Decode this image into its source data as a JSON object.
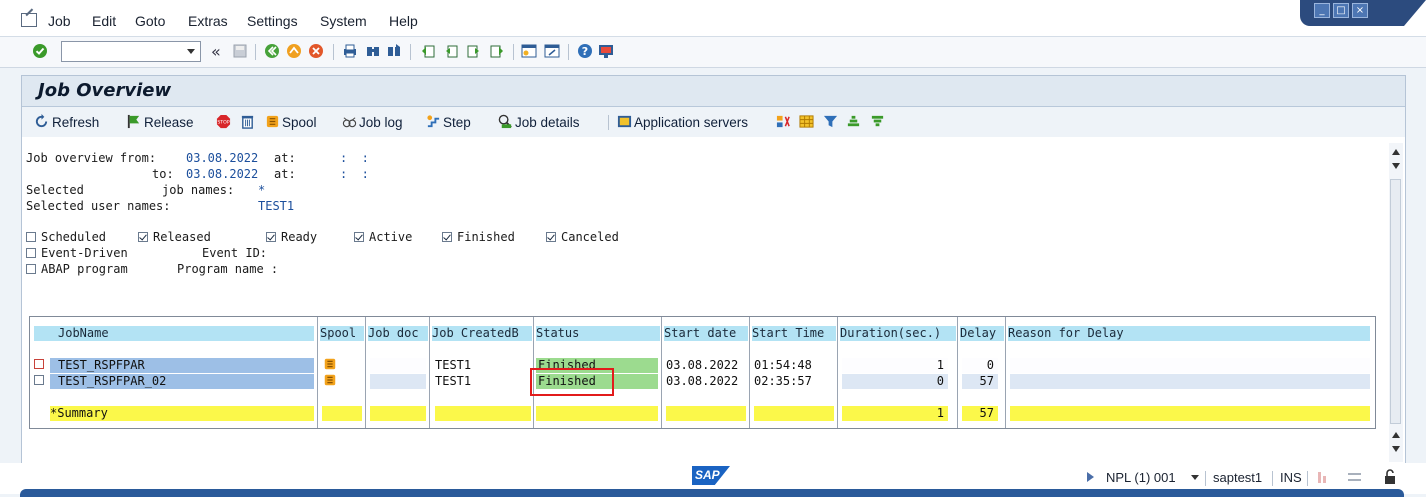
{
  "menu": {
    "items": [
      "Job",
      "Edit",
      "Goto",
      "Extras",
      "Settings",
      "System",
      "Help"
    ]
  },
  "window_controls": {
    "minimize": "_",
    "maximize": "□",
    "close": "×"
  },
  "toolbar": {
    "back_label": "«",
    "icons": [
      "enter-icon",
      "save-icon",
      "back-icon",
      "exit-icon",
      "cancel-icon",
      "print-icon",
      "find-icon",
      "find-next-icon",
      "first-page-icon",
      "previous-page-icon",
      "next-page-icon",
      "last-page-icon",
      "create-session-icon",
      "shortcut-icon",
      "help-icon",
      "customize-layout-icon"
    ]
  },
  "page": {
    "title": "Job Overview"
  },
  "app_toolbar": {
    "refresh": "Refresh",
    "release": "Release",
    "spool": "Spool",
    "job_log": "Job log",
    "step": "Step",
    "job_details": "Job details",
    "application_servers": "Application servers"
  },
  "criteria": {
    "overview_from_label": "Job overview from:",
    "from_date": "03.08.2022",
    "at_label1": "at:",
    "from_time": ":  :",
    "to_label": "to:",
    "to_date": "03.08.2022",
    "at_label2": "at:",
    "to_time": ":  :",
    "selected_label": "Selected",
    "job_names_label": "job names:",
    "job_names_value": "*",
    "user_names_label": "Selected user names:",
    "user_names_value": "TEST1"
  },
  "status_filters": [
    {
      "label": "Scheduled",
      "checked": false
    },
    {
      "label": "Released",
      "checked": true
    },
    {
      "label": "Ready",
      "checked": true
    },
    {
      "label": "Active",
      "checked": true
    },
    {
      "label": "Finished",
      "checked": true
    },
    {
      "label": "Canceled",
      "checked": true
    }
  ],
  "event_driven": {
    "label": "Event-Driven",
    "event_id_label": "Event ID:",
    "checked": false
  },
  "abap_program": {
    "label": "ABAP program",
    "program_name_label": "Program name :",
    "checked": false
  },
  "table": {
    "headers": [
      "JobName",
      "Spool",
      "Job doc",
      "Job CreatedB",
      "Status",
      "Start date",
      "Start Time",
      "Duration(sec.)",
      "Delay",
      "Reason for Delay"
    ],
    "rows": [
      {
        "job_name": "TEST_RSPFPAR",
        "job_doc": "",
        "created_by": "TEST1",
        "status": "Finished",
        "start_date": "03.08.2022",
        "start_time": "01:54:48",
        "duration": "1",
        "delay": "0",
        "reason": ""
      },
      {
        "job_name": "TEST_RSPFPAR_02",
        "job_doc": "",
        "created_by": "TEST1",
        "status": "Finished",
        "start_date": "03.08.2022",
        "start_time": "02:35:57",
        "duration": "0",
        "delay": "57",
        "reason": ""
      }
    ],
    "summary": {
      "label": "*Summary",
      "duration": "1",
      "delay": "57"
    }
  },
  "statusbar": {
    "system": "NPL (1) 001",
    "server": "saptest1",
    "mode": "INS"
  },
  "colors": {
    "header_bg": "#b3e3f4",
    "jobname_bg": "#9dbfe6",
    "finished_bg": "#9cdb8f",
    "summary_bg": "#fbf84a",
    "highlight": "#e21b1b"
  }
}
